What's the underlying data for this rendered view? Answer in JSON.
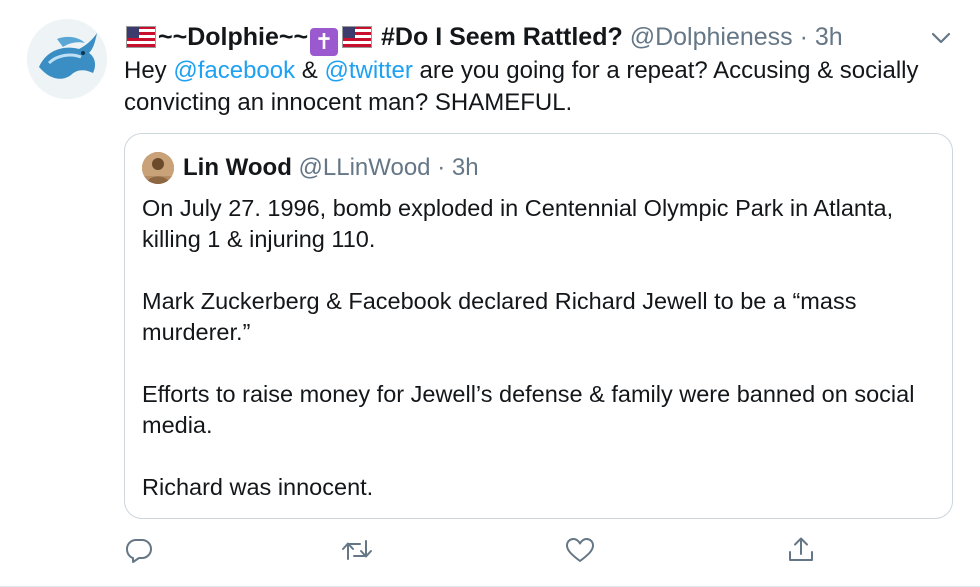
{
  "tweet": {
    "display_name": "~~Dolphie~~",
    "display_name_suffix": "#Do I Seem Rattled?",
    "handle": "@Dolphieness",
    "separator": "·",
    "time": "3h",
    "text_parts": {
      "prefix": "Hey ",
      "mention1": "@facebook",
      "mid": " & ",
      "mention2": "@twitter",
      "rest": "  are you going for a repeat? Accusing & socially convicting an innocent man? SHAMEFUL."
    }
  },
  "quoted": {
    "display_name": "Lin Wood",
    "handle": "@LLinWood",
    "separator": "·",
    "time": "3h",
    "paragraphs": [
      "On July 27. 1996, bomb exploded in Centennial Olympic Park in Atlanta, killing 1 & injuring 110.",
      "Mark Zuckerberg & Facebook declared Richard Jewell to be a “mass murderer.”",
      "Efforts to raise money for Jewell’s defense & family were banned on social media.",
      "Richard was innocent."
    ]
  },
  "icons": {
    "menu": "chevron-down-icon",
    "reply": "reply-icon",
    "retweet": "retweet-icon",
    "like": "heart-icon",
    "share": "share-icon"
  },
  "colors": {
    "link": "#1da1f2",
    "secondary": "#657786",
    "border": "#ccd6dd"
  }
}
